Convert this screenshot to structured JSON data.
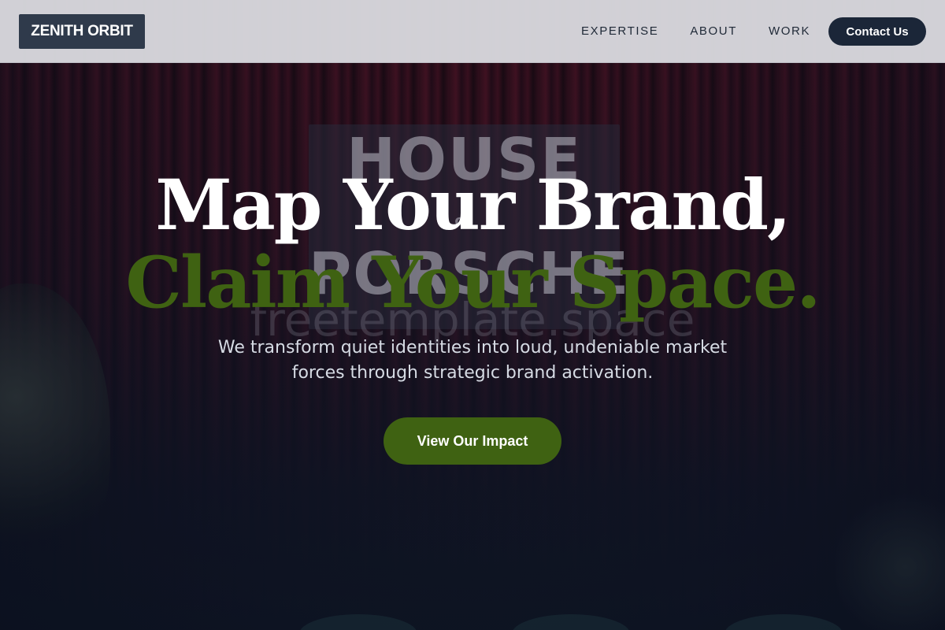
{
  "brand": {
    "logo_text": "ZENITH ORBIT"
  },
  "nav": {
    "links": [
      {
        "label": "EXPERTISE"
      },
      {
        "label": "ABOUT"
      },
      {
        "label": "WORK"
      }
    ],
    "contact_label": "Contact Us"
  },
  "background": {
    "sign_line_1": "HOUSE",
    "sign_line_2": "of",
    "sign_line_3": "PORSCHE",
    "watermark": "freetemplate.space"
  },
  "hero": {
    "headline_line_1": "Map Your Brand,",
    "headline_line_2": "Claim Your Space.",
    "subtext": "We transform quiet identities into loud, undeniable market forces through strategic brand activation.",
    "cta_label": "View Our Impact"
  },
  "colors": {
    "navbar": "#d8d8de",
    "logo_bg": "#2f3a4b",
    "contact_bg": "#1b2638",
    "accent_green": "#3f6212",
    "headline_white": "#ffffff"
  }
}
